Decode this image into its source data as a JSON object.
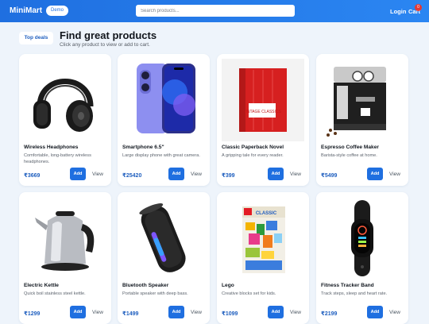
{
  "header": {
    "brand": "MiniMart",
    "badge": "Demo",
    "search_placeholder": "Search products...",
    "login": "Login",
    "cart": "Cart",
    "cart_count": "0"
  },
  "page": {
    "deals_label": "Top deals",
    "title": "Find great products",
    "subtitle": "Click any product to view or add to cart."
  },
  "products": [
    {
      "name": "Wireless Headphones",
      "desc": "Comfortable, long-battery wireless headphones.",
      "price": "₹3669",
      "add": "Add",
      "view": "View"
    },
    {
      "name": "Smartphone 6.5\"",
      "desc": "Large display phone with great camera.",
      "price": "₹25420",
      "add": "Add",
      "view": "View"
    },
    {
      "name": "Classic Paperback Novel",
      "desc": "A gripping tale for every reader.",
      "price": "₹399",
      "add": "Add",
      "view": "View"
    },
    {
      "name": "Espresso Coffee Maker",
      "desc": "Barista-style coffee at home.",
      "price": "₹5499",
      "add": "Add",
      "view": "View"
    },
    {
      "name": "Electric Kettle",
      "desc": "Quick boil stainless steel kettle.",
      "price": "₹1299",
      "add": "Add",
      "view": "View"
    },
    {
      "name": "Bluetooth Speaker",
      "desc": "Portable speaker with deep bass.",
      "price": "₹1499",
      "add": "Add",
      "view": "View"
    },
    {
      "name": "Lego",
      "desc": "Creative blocks set for kids.",
      "price": "₹1099",
      "add": "Add",
      "view": "View"
    },
    {
      "name": "Fitness Tracker Band",
      "desc": "Track steps, sleep and heart rate.",
      "price": "₹2199",
      "add": "Add",
      "view": "View"
    }
  ],
  "image_text": {
    "book_cover": "VINTAGE CLASSICS",
    "lego_box": "CLASSIC"
  },
  "colors": {
    "accent": "#1f6fe0",
    "price": "#1f5fbf",
    "cart_badge": "#e53935",
    "background": "#eef4fb"
  }
}
